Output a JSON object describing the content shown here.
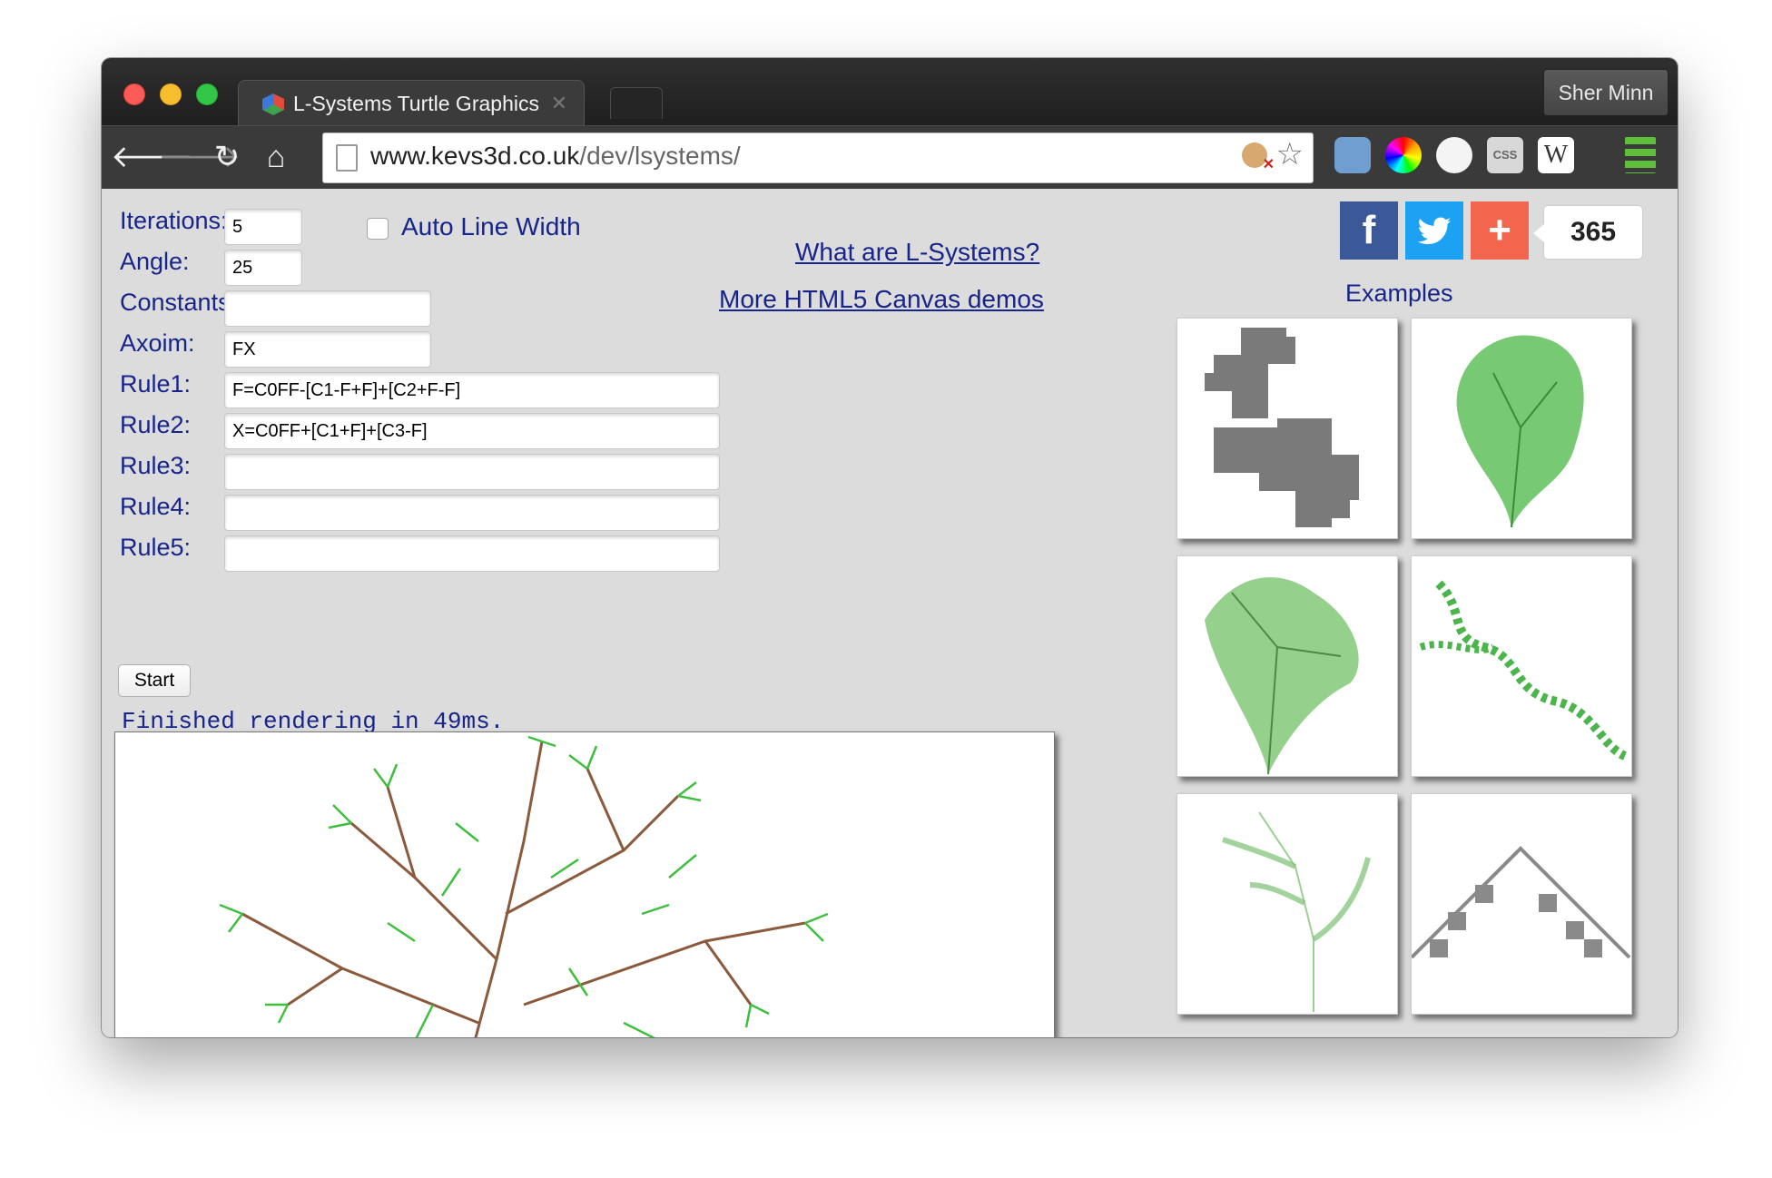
{
  "browser": {
    "tab_title": "L-Systems Turtle Graphics",
    "profile_name": "Sher Minn",
    "url_host": "www.kevs3d.co.uk",
    "url_path": "/dev/lsystems/",
    "extension_css_label": "CSS",
    "extension_w_label": "W"
  },
  "form": {
    "iterations_label": "Iterations:",
    "iterations_value": "5",
    "auto_line_width_label": "Auto Line Width",
    "auto_line_width_checked": false,
    "angle_label": "Angle:",
    "angle_value": "25",
    "constants_label": "Constants:",
    "constants_value": "",
    "axiom_label": "Axoim:",
    "axiom_value": "FX",
    "rule1_label": "Rule1:",
    "rule1_value": "F=C0FF-[C1-F+F]+[C2+F-F]",
    "rule2_label": "Rule2:",
    "rule2_value": "X=C0FF+[C1+F]+[C3-F]",
    "rule3_label": "Rule3:",
    "rule3_value": "",
    "rule4_label": "Rule4:",
    "rule4_value": "",
    "rule5_label": "Rule5:",
    "rule5_value": "",
    "start_label": "Start",
    "status_text": "Finished rendering in 49ms."
  },
  "links": {
    "what_are": "What are L-Systems?",
    "more_demos": "More HTML5 Canvas demos"
  },
  "social": {
    "facebook_glyph": "f",
    "plus_glyph": "+",
    "share_count": "365"
  },
  "examples": {
    "title": "Examples",
    "thumbnails": [
      "dragon-curve",
      "green-bush",
      "green-tree",
      "green-vine",
      "fern",
      "sierpinski-triangle"
    ]
  },
  "colors": {
    "label_blue": "#17248a",
    "plant_green": "#3fbf3f",
    "branch_brown": "#8b5a3c"
  }
}
